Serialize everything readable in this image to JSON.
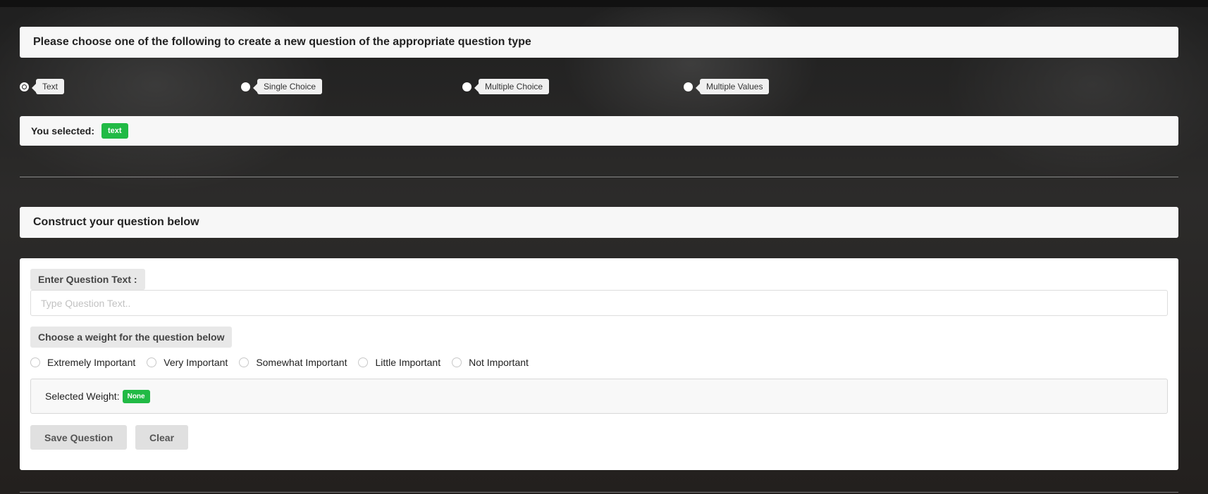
{
  "header": {
    "title": "Please choose one of the following to create a new question of the appropriate question type"
  },
  "question_types": [
    {
      "label": "Text",
      "selected": true
    },
    {
      "label": "Single Choice",
      "selected": false
    },
    {
      "label": "Multiple Choice",
      "selected": false
    },
    {
      "label": "Multiple Values",
      "selected": false
    }
  ],
  "selection": {
    "label": "You selected:",
    "value": "text"
  },
  "construct": {
    "title": "Construct your question below"
  },
  "form": {
    "question_label": "Enter Question Text :",
    "question_placeholder": "Type Question Text..",
    "weight_label": "Choose a weight for the question below",
    "weights": [
      "Extremely Important",
      "Very Important",
      "Somewhat Important",
      "Little Important",
      "Not Important"
    ],
    "selected_weight_label": "Selected Weight:",
    "selected_weight_value": "None",
    "save_label": "Save Question",
    "clear_label": "Clear"
  },
  "colors": {
    "badge_green": "#21ba45",
    "panel_bg": "#f7f7f7"
  }
}
